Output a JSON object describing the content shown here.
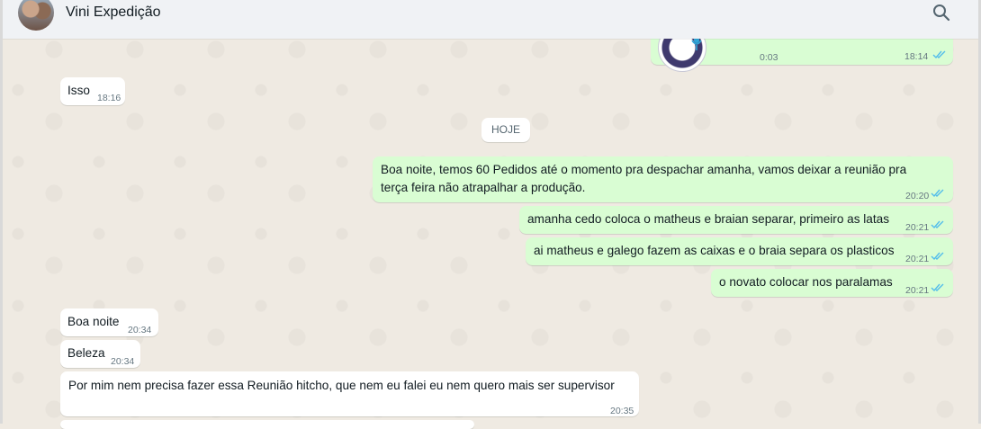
{
  "header": {
    "contact_name": "Vini Expedição",
    "search_icon": "search-icon"
  },
  "voice_message": {
    "duration": "0:03",
    "time": "18:14",
    "status": "read"
  },
  "day_separator": "HOJE",
  "messages": [
    {
      "direction": "in",
      "text": "Isso",
      "time": "18:16"
    },
    {
      "direction": "out",
      "lines": [
        "Boa noite, temos 60 Pedidos até o momento pra despachar amanha, vamos deixar a reunião pra",
        "terça feira não atrapalhar a produção."
      ],
      "time": "20:20",
      "status": "read"
    },
    {
      "direction": "out",
      "text": "amanha cedo coloca o matheus e braian separar, primeiro as latas",
      "time": "20:21",
      "status": "read"
    },
    {
      "direction": "out",
      "text": "ai matheus e galego fazem as caixas e o braia separa os plasticos",
      "time": "20:21",
      "status": "read"
    },
    {
      "direction": "out",
      "text": "o novato colocar nos paralamas",
      "time": "20:21",
      "status": "read"
    },
    {
      "direction": "in",
      "text": "Boa noite",
      "time": "20:34"
    },
    {
      "direction": "in",
      "text": "Beleza",
      "time": "20:34"
    },
    {
      "direction": "in",
      "text": "Por mim nem precisa fazer essa Reunião hitcho, que nem eu falei eu nem quero mais ser supervisor",
      "time": "20:35"
    }
  ],
  "colors": {
    "incoming_bubble": "#ffffff",
    "outgoing_bubble": "#d9fdd3",
    "read_ticks": "#53bdeb",
    "wallpaper": "#efeae2",
    "header_bg": "#f0f2f5"
  }
}
